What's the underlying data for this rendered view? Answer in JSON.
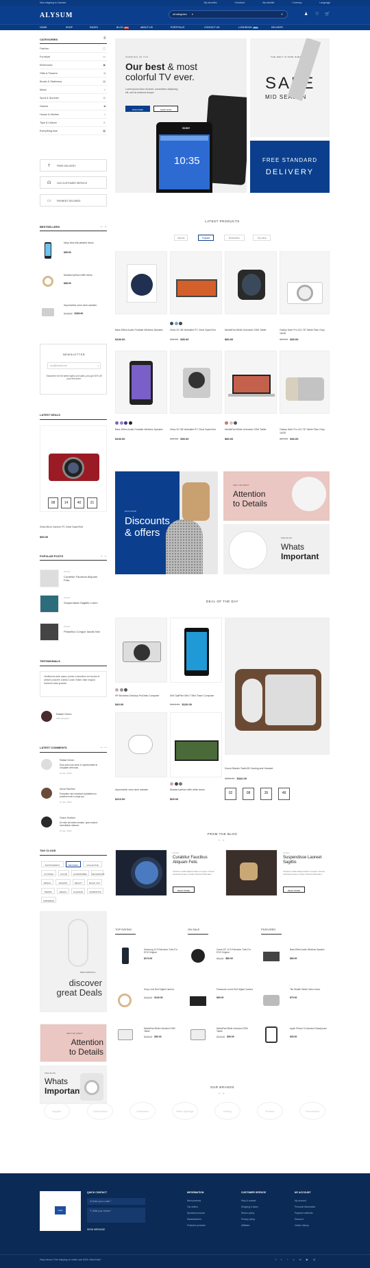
{
  "topbar": {
    "shipping": "Now shipping to Canada",
    "links": [
      "My favorites",
      "Checkout",
      "My wishlist",
      "Currency",
      "Language"
    ]
  },
  "header": {
    "logo": "ALYSUM",
    "search_category": "all categories",
    "icons": [
      "user-icon",
      "heart-icon",
      "cart-icon"
    ]
  },
  "nav": {
    "items": [
      "Home",
      "Shop",
      "Pages",
      "Blog",
      "About Us",
      "Portfolio",
      "Contact Us",
      "Lookbook",
      "Delivery"
    ],
    "blog_badge": "Hot",
    "lookbook_badge": "New"
  },
  "sidebar": {
    "categories_title": "Categories",
    "categories": [
      "Fashion",
      "Furniture",
      "Electronics",
      "Gifts & Flowers",
      "Books & Stationery",
      "Music",
      "Sport & Summer",
      "Games",
      "House & Kitchen",
      "Toys & Leisure",
      "Everything else"
    ],
    "services": [
      "Free delivery",
      "24/4 customer service",
      "Payment secured"
    ],
    "bestsellers_title": "Bestsellers",
    "bestsellers": [
      {
        "name": "Navy blue slik pleated dress",
        "price": "$99.90"
      },
      {
        "name": "Mustard yellow ruffle dress",
        "price": "$68.90"
      },
      {
        "name": "Asymmetric crew neck sweater",
        "old": "$149.90",
        "price": "$189.90"
      }
    ],
    "newsletter": {
      "title": "Newsletter",
      "placeholder": "you@email.com",
      "text": "Subscribe for the latest styles and sales, plus get 20% off your first order."
    },
    "deals_title": "Latest deals",
    "deal": {
      "countdown": [
        "08",
        "14",
        "40",
        "21"
      ],
      "name": "Zeiss Micro Cannon PC Clear SuperSoft",
      "price": "$50.00"
    },
    "popular_title": "Popular posts",
    "posts": [
      {
        "date": "21 Dec",
        "title": "Curabitur Faucibus Aliquam Felis"
      },
      {
        "date": "21 Dec",
        "title": "Suspendisse Sagittis Lorem"
      },
      {
        "date": "21 Dec",
        "title": "Phasellus Congue Iaculis Nisl"
      }
    ],
    "testimonials_title": "Testimonials",
    "testimonial": {
      "text": "Vestibulum ante ipsum primis in faucibus orci luctus et ultrices posuere cubilia Curae; Etiam vitae magna tincidunt vitae gravida.",
      "name": "Rafael Green",
      "role": "Web Designer"
    },
    "comments_title": "Latest comments",
    "comments": [
      {
        "name": "Rafael Green",
        "text": "Duis aute irure dolor in reprehenderit in voluptate velit esse.",
        "date": "21 Jan, 2018"
      },
      {
        "name": "Anna Ramirez",
        "text": "Excepteur sint occaecat cupidatat non proident sunt in culpa qui.",
        "date": "21 Jan, 2018"
      },
      {
        "name": "Grace Hudson",
        "text": "Ut enim ad minim veniam, quis nostrud exercitation ullamco.",
        "date": "21 Jan, 2018"
      }
    ],
    "tags_title": "Tag cloud",
    "tags": [
      "Photography",
      "Branded",
      "Collective",
      "Clothing",
      "Color",
      "Accessories",
      "Decoration",
      "Design",
      "Fashion",
      "Beauty",
      "Black list",
      "Trends",
      "Design",
      "Glamour",
      "Inspiration",
      "Swimwear"
    ]
  },
  "hero": {
    "kicker": "Samsung 4k TVs",
    "title_bold": "Our best",
    "title_rest": " & most colorful TV ever.",
    "desc": "Lorem ipsum dolor sit amet, consectetur adipiscing elit, sed do eiusmod tempor.",
    "btn1": "Discover",
    "btn2": "Shop now",
    "phone_brand": "SONY",
    "phone_time": "10:35",
    "side_kicker": "The wait is now over",
    "side_big": "SALE",
    "side_sub": "Mid season",
    "promo_line1": "Free standard",
    "promo_line2": "Delivery"
  },
  "latest": {
    "title": "Latest products",
    "tabs": [
      "Special",
      "Popular",
      "Bestsellers",
      "Top rated"
    ],
    "active": 1,
    "products": [
      {
        "name": "Bass Effect Audio Portable Wireless Speaker",
        "price": "$100.00",
        "old": ""
      },
      {
        "name": "Zeiss 32 GB Netmallet PC Clear SuperOne",
        "price": "$50.00",
        "old": "$65.00"
      },
      {
        "name": "MediaPad White Unlocked GSM Tablet",
        "price": "$80.00",
        "old": ""
      },
      {
        "name": "Galaxy Note Pro 4G LTE Tablet Titan Gray 16GB",
        "price": "$60.00",
        "old": "$80.00"
      },
      {
        "name": "Bass Effect Audio Portable Wireless Speaker",
        "price": "$100.00",
        "old": ""
      },
      {
        "name": "Zeiss 32 GB Netmallet PC Clear SuperOne",
        "price": "$50.00",
        "old": "$65.00"
      },
      {
        "name": "MediaPad White Unlocked GSM Tablet",
        "price": "$80.00",
        "old": ""
      },
      {
        "name": "Galaxy Note Pro 4G LTE Tablet Titan Gray 16GB",
        "price": "$60.00",
        "old": "$80.00"
      }
    ]
  },
  "banners": {
    "b1_kicker": "Exclusive",
    "b1_line1": "Discounts",
    "b1_line2": "& offers",
    "b2_kicker": "See the great",
    "b2_line1": "Attention",
    "b2_line2": "to Details",
    "b3_kicker": "Focus on",
    "b3_line1": "Whats",
    "b3_line2": "Important"
  },
  "deal_day": {
    "title": "Deal of the day",
    "items": [
      {
        "name": "HP Business Desktop ProDesk Computer",
        "price": "$40.00"
      },
      {
        "name": "Dell OptiPlex Mini 7 Mini Tower Computer",
        "price": "$120.00",
        "old": "$160.00"
      },
      {
        "name": "Asymmetric crew neck sweater",
        "price": "$210.00"
      },
      {
        "name": "Mustard yellow ruffle white dress",
        "price": "$65.00"
      }
    ],
    "feature": {
      "name": "Sound Blaster Tactic3D Gaming and Headset",
      "price": "$342.00",
      "old": "$350.00",
      "countdown": [
        "02",
        "08",
        "35",
        "48"
      ]
    }
  },
  "blog": {
    "title": "From the blog",
    "posts": [
      {
        "date": "21 Dec",
        "title": "Curabitur Faucibus Aliquam Felis",
        "text": "Vivamus mollis aliquet tellus in tempor. Donec vehicula semper mauris ultricies bibendum.",
        "btn": "Read more"
      },
      {
        "date": "21 Dec",
        "title": "Suspendisse Laoreet Sagittis",
        "text": "Vivamus mollis aliquet tellus in tempor. Donec vehicula semper mauris ultricies bibendum.",
        "btn": "Read more"
      }
    ]
  },
  "lower_banners": {
    "d1_kicker": "New arrivals",
    "d1_line1": "discover",
    "d1_line2": "great Deals",
    "d2_kicker": "See the great",
    "d2_line1": "Attention",
    "d2_line2": "to Details",
    "d3_kicker": "Focus on",
    "d3_line1": "Whats",
    "d3_line2": "Important"
  },
  "lists": [
    {
      "title": "Top rating",
      "items": [
        {
          "name": "Samsung 12.9 Extension Tube For EOS Original",
          "price": "$174.00"
        },
        {
          "name": "Sony Lens Red Digital Camera",
          "price": "$140.00",
          "old": "$160.00"
        },
        {
          "name": "MediaPad White Unlocked GSM Tablet",
          "price": "$90.00",
          "old": "$100.00"
        }
      ]
    },
    {
      "title": "On sale",
      "items": [
        {
          "name": "Canon EF 12 II Extension Tube For EOS Original",
          "price": "$80.00",
          "old": "$90.00"
        },
        {
          "name": "Panasonic Lumix Red Digital Camera",
          "price": "$60.00"
        },
        {
          "name": "MediaPad White Unlocked GSM Tablet",
          "price": "$99.00",
          "old": "$120.00"
        }
      ]
    },
    {
      "title": "Featured",
      "items": [
        {
          "name": "Bass Effect Audio Wireless Speaker",
          "price": "$80.00"
        },
        {
          "name": "Tite Stealth Tablet Carbo Armor",
          "price": "$70.00"
        },
        {
          "name": "Apple iPhone 5 Unlocked Smartphone",
          "price": "$30.00"
        }
      ]
    }
  ],
  "brands": {
    "title": "Our brands",
    "names": [
      "Spyder",
      "Timberland",
      "Yellowise",
      "Palm Springs",
      "Oakley",
      "Pirates",
      "Greenwich"
    ]
  },
  "footer": {
    "logo": "zeiss",
    "quick_title": "Quick contact",
    "email_placeholder": "Enter your e-mail *",
    "review_placeholder": "Write your review *",
    "send": "Send message",
    "cols": [
      {
        "title": "Information",
        "links": [
          "New products",
          "Top sellers",
          "Specials products",
          "Manufacturers",
          "Featured products"
        ]
      },
      {
        "title": "Customer service",
        "links": [
          "Help & contact",
          "Shipping & taxes",
          "Return policy",
          "Privacy policy",
          "Affiliates"
        ]
      },
      {
        "title": "My account",
        "links": [
          "My account",
          "Personal information",
          "Payment methods",
          "Discount",
          "Orders history"
        ]
      }
    ],
    "bottom_text": "Easy returns. Free shipping on orders over $100. Need help?",
    "social": [
      "facebook-icon",
      "twitter-icon",
      "rss-icon",
      "vimeo-icon",
      "linkedin-icon",
      "youtube-icon",
      "instagram-icon"
    ]
  },
  "colors": {
    "primary": "#0b3f8d",
    "footer": "#0b2a55",
    "pink": "#eac7c2"
  }
}
